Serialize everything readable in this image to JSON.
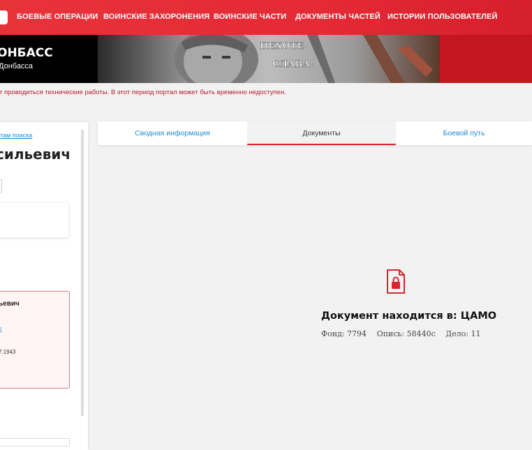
{
  "nav": {
    "items": [
      "БОЕВЫЕ ОПЕРАЦИИ",
      "ВОИНСКИЕ ЗАХОРОНЕНИЯ",
      "ВОИНСКИЕ ЧАСТИ",
      "ДОКУМЕНТЫ ЧАСТЕЙ",
      "ИСТОРИИ ПОЛЬЗОВАТЕЛЕЙ"
    ]
  },
  "banner": {
    "title": "ОНБАСС",
    "subtitle": "Донбасса",
    "image_text": [
      "ПЕХОТЕ-",
      "СЛАВА!"
    ]
  },
  "notice": "т проводиться технические работы. В этот период портал может быть временно недоступен.",
  "sidebar": {
    "back_link": "там поиска",
    "person_name": "сильевич",
    "card": {
      "name": "ьевич",
      "link": "п",
      "date": "7.1943"
    }
  },
  "tabs": [
    "Сводная информация",
    "Документы",
    "Боевой путь"
  ],
  "active_tab": "Документы",
  "document": {
    "location": "Документ находится в: ЦАМО",
    "fond": "Фонд: 7794",
    "opis": "Опись: 58440с",
    "delo": "Дело: 11"
  },
  "colors": {
    "accent": "#e8323a",
    "link": "#1f8bd3",
    "icon": "#d9252f"
  }
}
